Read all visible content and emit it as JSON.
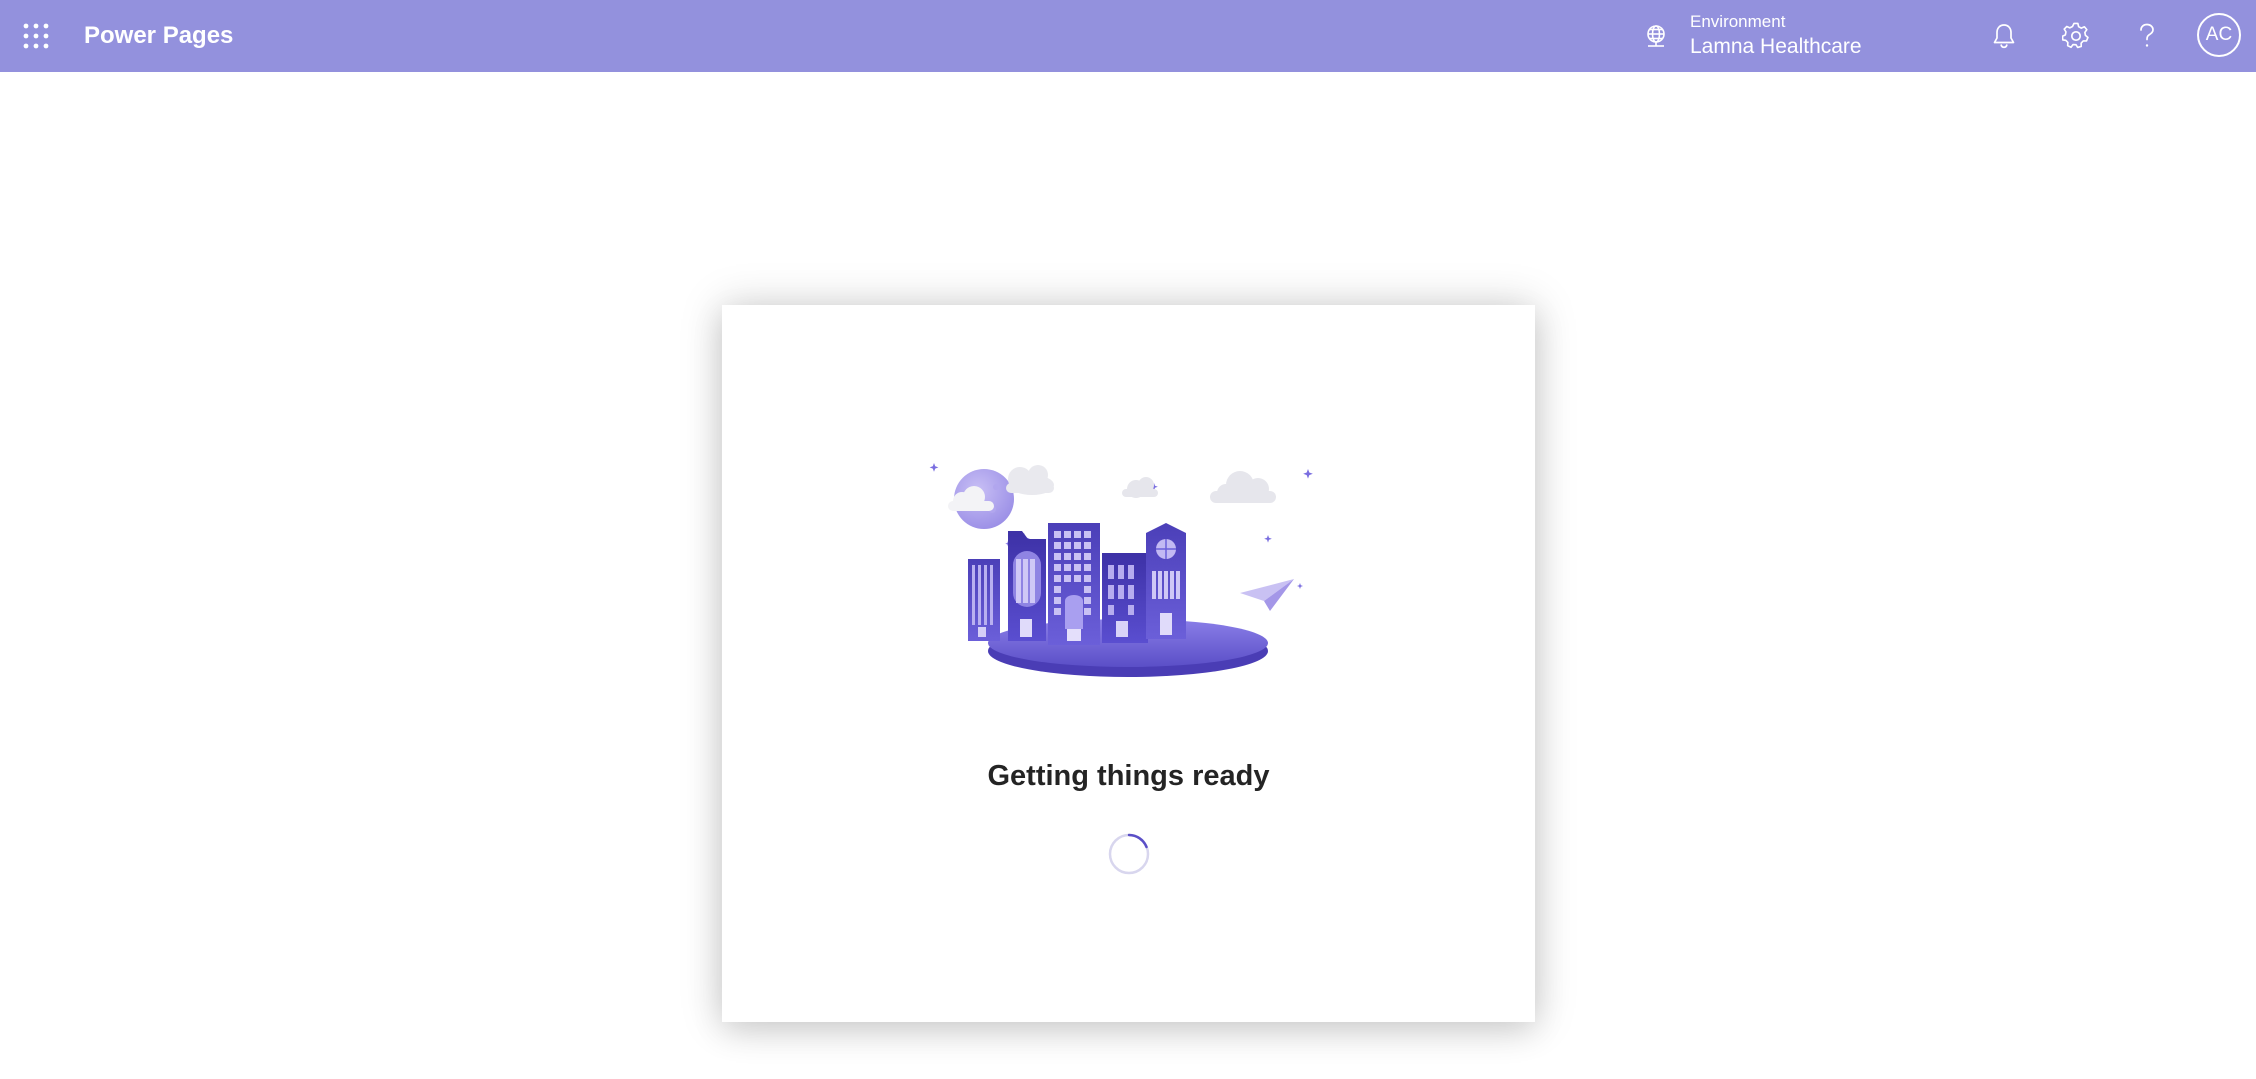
{
  "header": {
    "app_title": "Power Pages",
    "waffle_icon": "app-launcher-icon",
    "environment": {
      "icon": "globe-icon",
      "label": "Environment",
      "name": "Lamna Healthcare"
    },
    "notifications_icon": "bell-icon",
    "settings_icon": "gear-icon",
    "help_icon": "help-icon",
    "avatar_initials": "AC",
    "background_color": "#9391dd"
  },
  "loading_card": {
    "illustration": "city-buildings-illustration",
    "status_text": "Getting things ready",
    "spinner_icon": "loading-spinner-icon",
    "accent_color": "#5b4fc7"
  }
}
